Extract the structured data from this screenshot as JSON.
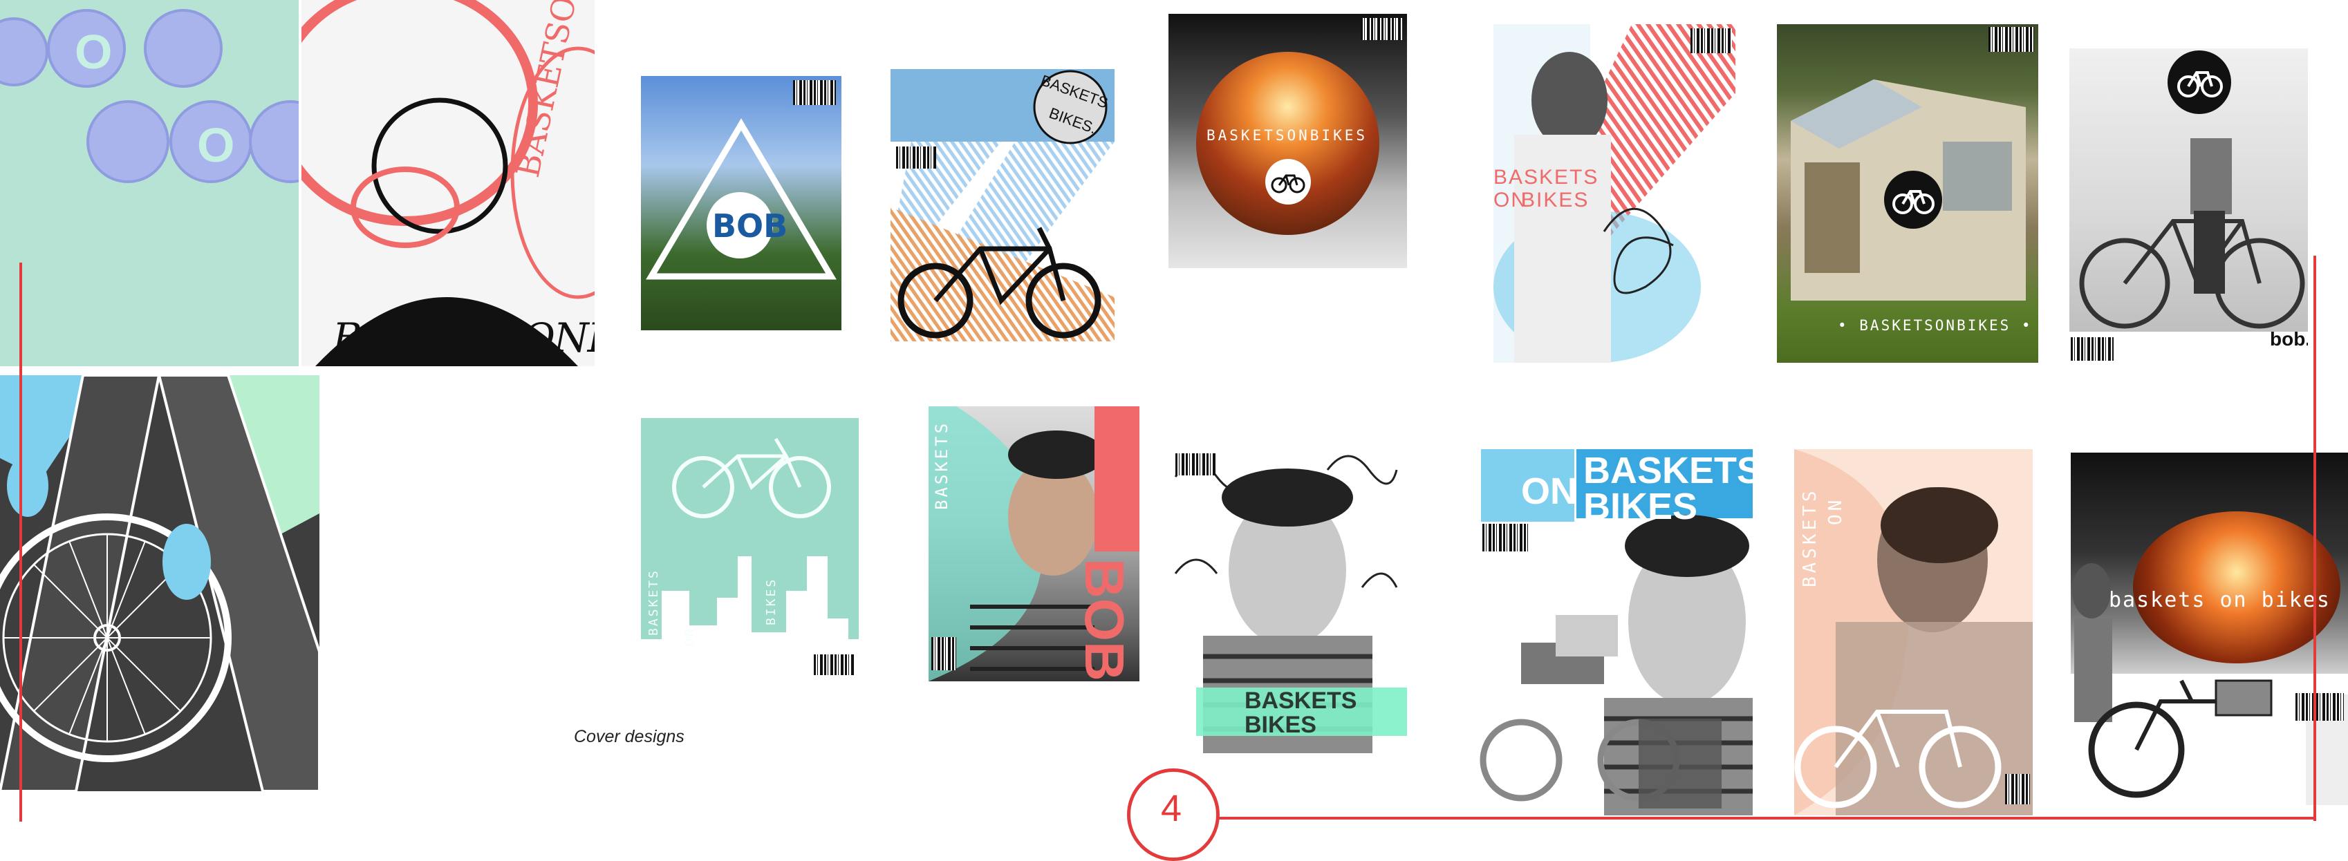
{
  "caption": "Cover designs",
  "page_number": "4",
  "logo": {
    "bob": "BOB",
    "bob_small": "bob.",
    "bob_lower": "bob"
  },
  "brand": {
    "baskets_on_bikes": "BASKETSONBIKES",
    "baskets_on_bikes_dotted": "• BASKETSONBIKES •",
    "baskets_on_bikes_lower": "baskets on bikes",
    "baskets": "BASKETS",
    "on": "ON",
    "bikes": "BIKES",
    "bikes_dot": "BIKES.",
    "baskets_on_bikes_arc": "BASKETSONBIKES",
    "baskets_vertical": "BASKETS",
    "on_vertical": "ON",
    "bikes_vertical": "BIKES",
    "bob_o": "O"
  },
  "colors": {
    "accent_red": "#e33b3b",
    "mint": "#9bdac8",
    "coral": "#f06a6a",
    "sky": "#7fd0ef",
    "lavender": "#a9b4ec",
    "dark": "#3e3e3e"
  }
}
